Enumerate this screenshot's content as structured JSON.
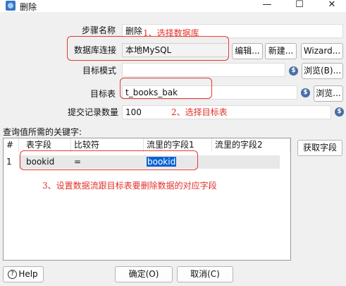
{
  "window": {
    "title": "删除",
    "controls": {
      "minimize": "—",
      "maximize": "☐",
      "close": "✕"
    }
  },
  "form": {
    "step_name": {
      "label": "步骤名称",
      "value": "删除"
    },
    "connection": {
      "label": "数据库连接",
      "value": "本地MySQL",
      "edit": "编辑...",
      "new": "新建...",
      "wizard": "Wizard..."
    },
    "schema": {
      "label": "目标模式",
      "value": "",
      "browse": "浏览(B)..."
    },
    "table": {
      "label": "目标表",
      "value": "t_books_bak",
      "browse": "浏览..."
    },
    "commit": {
      "label": "提交记录数量",
      "value": "100"
    }
  },
  "keys_section": {
    "label": "查询值所需的关键字:",
    "get_fields": "获取字段",
    "columns": [
      "#",
      "表字段",
      "比较符",
      "流里的字段1",
      "流里的字段2"
    ],
    "rows": [
      {
        "num": "1",
        "table_field": "bookid",
        "comparator": "=",
        "stream_field1": "bookid",
        "stream_field2": ""
      }
    ]
  },
  "footer": {
    "help": "Help",
    "ok": "确定(O)",
    "cancel": "取消(C)"
  },
  "annotations": {
    "a1": "1、选择数据库",
    "a2": "2、选择目标表",
    "a3": "3、设置数据流跟目标表要删除数据的对应字段"
  }
}
